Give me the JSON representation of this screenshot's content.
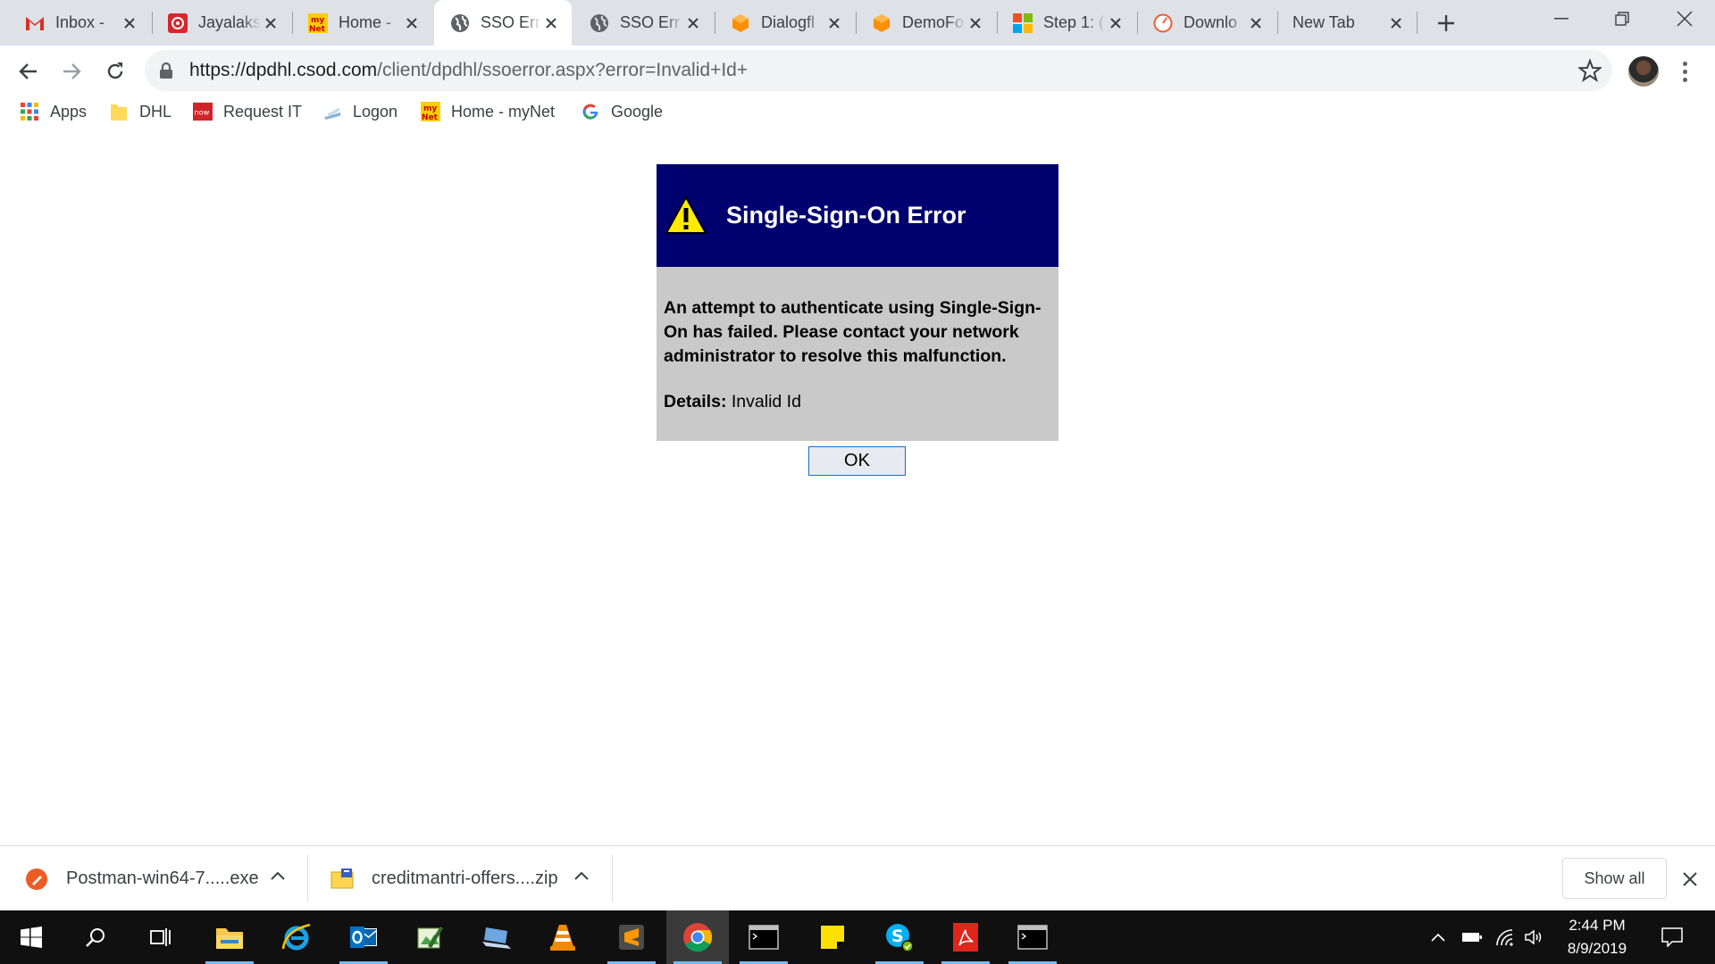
{
  "tabs": [
    {
      "title": "Inbox -",
      "icon": "gmail-icon",
      "active": false
    },
    {
      "title": "Jayalaks",
      "icon": "red-circle-icon",
      "active": false
    },
    {
      "title": "Home -",
      "icon": "mynet-icon",
      "active": false
    },
    {
      "title": "SSO Err",
      "icon": "globe-icon",
      "active": true
    },
    {
      "title": "SSO Err",
      "icon": "globe-icon",
      "active": false
    },
    {
      "title": "Dialogfl",
      "icon": "dialogflow-icon",
      "active": false
    },
    {
      "title": "DemoFo",
      "icon": "dialogflow-icon",
      "active": false
    },
    {
      "title": "Step 1: (",
      "icon": "microsoft-icon",
      "active": false
    },
    {
      "title": "Downlo",
      "icon": "download-gauge-icon",
      "active": false
    },
    {
      "title": "New Tab",
      "icon": "none",
      "active": false
    }
  ],
  "omnibox": {
    "url_host": "https://dpdhl.csod.com",
    "url_path": "/client/dpdhl/ssoerror.aspx?error=Invalid+Id+"
  },
  "bookmarks": [
    {
      "label": "Apps",
      "icon": "apps-grid-icon"
    },
    {
      "label": "DHL",
      "icon": "folder-icon"
    },
    {
      "label": "Request IT",
      "icon": "now-icon"
    },
    {
      "label": "Logon",
      "icon": "logon-icon"
    },
    {
      "label": "Home - myNet",
      "icon": "mynet-icon"
    },
    {
      "label": "Google",
      "icon": "google-icon"
    }
  ],
  "dialog": {
    "title": "Single-Sign-On Error",
    "message": "An attempt to authenticate using Single-Sign-On has failed. Please contact your network administrator to resolve this malfunction.",
    "details_label": "Details:",
    "details_value": "Invalid Id",
    "ok_label": "OK"
  },
  "downloads": [
    {
      "name": "Postman-win64-7.....exe",
      "icon": "postman-icon"
    },
    {
      "name": "creditmantri-offers....zip",
      "icon": "zip-icon"
    }
  ],
  "downloads_show_all": "Show all",
  "taskbar": {
    "time": "2:44 PM",
    "date": "8/9/2019"
  },
  "favicons": {
    "mynet_text_top": "my",
    "mynet_text_bottom": "Net",
    "now_text": "now"
  },
  "colors": {
    "dialog_header": "#00006f",
    "dialog_body": "#c9c9c9",
    "tabstrip": "#dee1e6",
    "taskbar": "#101010"
  }
}
